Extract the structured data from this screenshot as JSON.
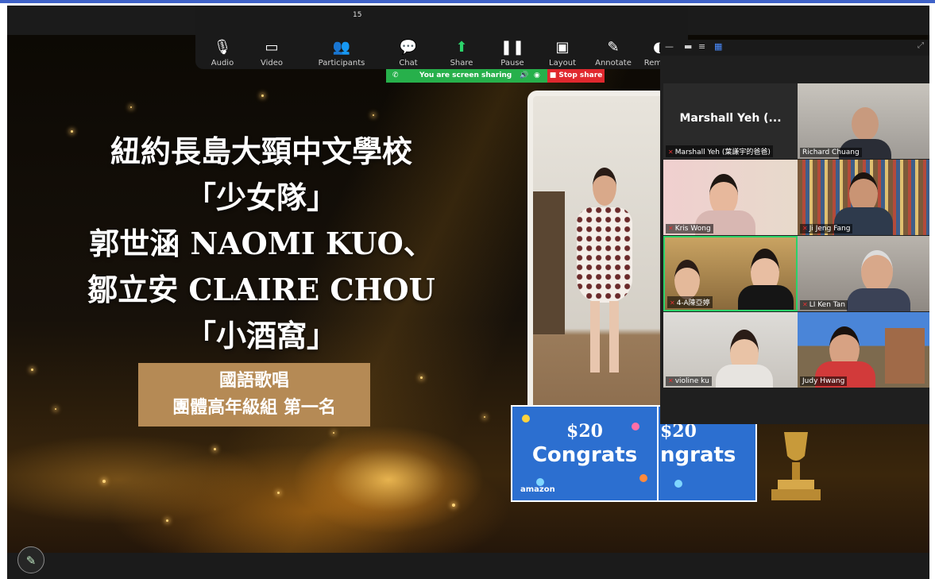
{
  "toolbar": {
    "audio": "Audio",
    "video": "Video",
    "participants": "Participants",
    "participants_count": "15",
    "chat": "Chat",
    "share": "Share",
    "pause": "Pause",
    "layout": "Layout",
    "annotate": "Annotate",
    "remote": "Remote"
  },
  "share_status": {
    "sharing_text": "You are screen sharing",
    "stop_label": "Stop share"
  },
  "slide": {
    "title_lines": [
      "紐約長島大頸中文學校",
      "「少女隊」",
      "郭世涵 NAOMI KUO、",
      "鄒立安 CLAIRE CHOU",
      "「小酒窩」"
    ],
    "award_lines": [
      "國語歌唱",
      "團體高年級組 第一名"
    ],
    "gift_card_amount": "$20",
    "gift_card_text": "Congrats",
    "gift_card_text_cropped": "ngrats",
    "gift_card_brand": "amazon"
  },
  "gallery": {
    "participants": [
      {
        "name": "Marshall Yeh (...",
        "label": "Marshall Yeh (葉謙宇的爸爸)",
        "muted": true
      },
      {
        "name": "Richard Chuang",
        "muted": false
      },
      {
        "name": "Kris Wong",
        "muted": true
      },
      {
        "name": "Ji Jeng Fang",
        "muted": true
      },
      {
        "name": "4-A陳亞婷",
        "muted": true
      },
      {
        "name": "LI Ken Tan",
        "muted": true
      },
      {
        "name": "violine ku",
        "muted": true
      },
      {
        "name": "Judy Hwang",
        "muted": false
      }
    ]
  },
  "colors": {
    "share_green": "#27b04b",
    "stop_red": "#e0282e",
    "active_speaker": "#2bd36a",
    "award_box": "#b58a55",
    "gift_blue": "#2c6fd0"
  }
}
